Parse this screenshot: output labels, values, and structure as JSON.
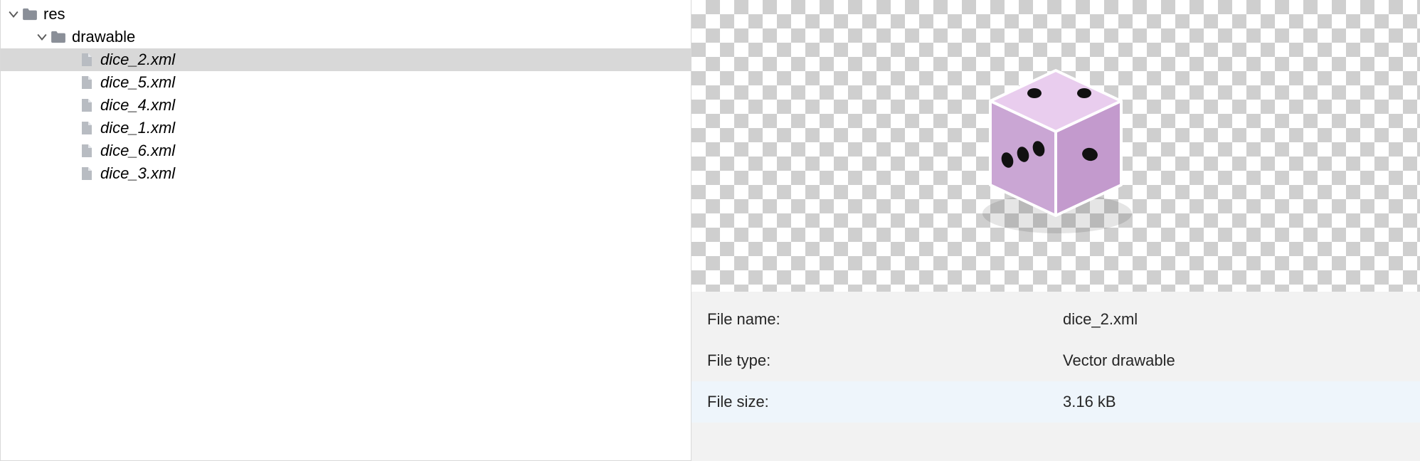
{
  "tree": {
    "root": {
      "name": "res",
      "expanded": true
    },
    "folder": {
      "name": "drawable",
      "expanded": true
    },
    "files": [
      {
        "name": "dice_2.xml",
        "selected": true
      },
      {
        "name": "dice_5.xml",
        "selected": false
      },
      {
        "name": "dice_4.xml",
        "selected": false
      },
      {
        "name": "dice_1.xml",
        "selected": false
      },
      {
        "name": "dice_6.xml",
        "selected": false
      },
      {
        "name": "dice_3.xml",
        "selected": false
      }
    ]
  },
  "details": {
    "rows": [
      {
        "key": "File name:",
        "value": "dice_2.xml"
      },
      {
        "key": "File type:",
        "value": "Vector drawable"
      },
      {
        "key": "File size:",
        "value": "3.16 kB"
      }
    ]
  },
  "preview": {
    "artwork": "dice-isometric-purple"
  }
}
